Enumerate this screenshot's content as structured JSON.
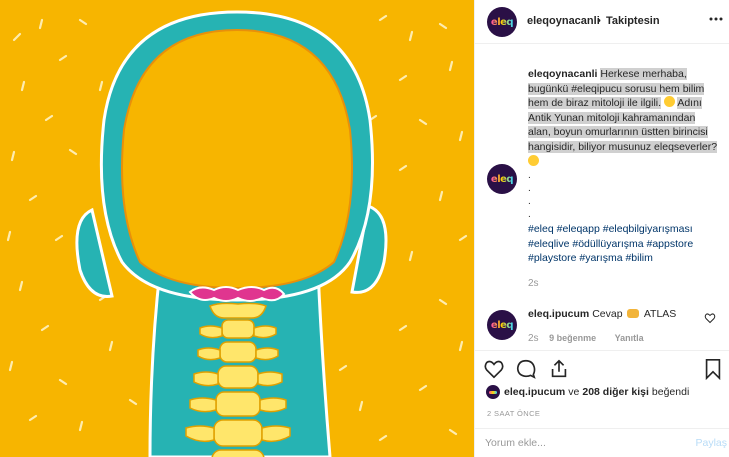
{
  "post": {
    "username": "eleqoynacanli",
    "separator": "•",
    "follow_status": "Takiptesin",
    "avatar_text": "eleq",
    "caption": {
      "username": "eleqoynacanli",
      "text_1": "Herkese merhaba, bugünkü #eleqipucu sorusu hem bilim hem de biraz mitoloji ile ilgili.",
      "text_2": "Adını Antik Yunan mitoloji kahramanından alan, boyun omurlarının üstten birincisi hangisidir, biliyor musunuz eleqseverler?",
      "dots": [
        ".",
        ".",
        ".",
        "."
      ],
      "hashtags_1": "#eleq #eleqapp #eleqbilgiyarışması",
      "hashtags_2": "#eleqlive #ödüllüyarışma #appstore",
      "hashtags_3": "#playstore #yarışma #bilim",
      "time": "2s"
    },
    "reply": {
      "username": "eleq.ipucum",
      "text_before": "Cevap",
      "text_after": "ATLAS",
      "time": "2s",
      "likes": "9 beğenme",
      "reply_label": "Yanıtla"
    },
    "likes": {
      "liker": "eleq.ipucum",
      "connector": "ve",
      "others": "208 diğer kişi",
      "suffix": "beğendi"
    },
    "time_ago": "2 SAAT ÖNCE",
    "comment": {
      "placeholder": "Yorum ekle...",
      "post_label": "Paylaş"
    }
  },
  "colors": {
    "background_yellow": "#f7b500",
    "neck_teal": "#26b3b3",
    "spine_yellow": "#ffe66b",
    "atlas_pink": "#e0358f",
    "hashtag_blue": "#003569"
  },
  "icons": [
    "more-icon",
    "heart-icon",
    "comment-icon",
    "share-icon",
    "bookmark-icon"
  ]
}
